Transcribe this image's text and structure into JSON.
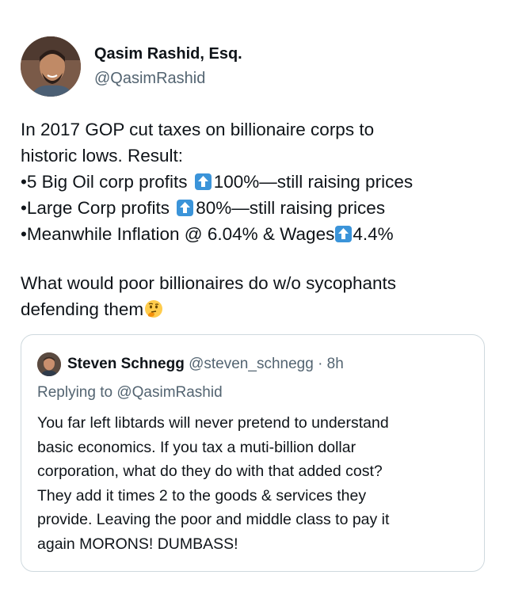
{
  "author": {
    "name": "Qasim Rashid, Esq.",
    "handle": "@QasimRashid"
  },
  "tweet": {
    "line1": "In 2017 GOP cut taxes on billionaire corps to",
    "line2": "historic lows. Result:",
    "bullet1_pre": "•5 Big Oil corp profits",
    "bullet1_post": "100%—still raising prices",
    "bullet2_pre": "•Large Corp profits",
    "bullet2_post": "80%—still raising prices",
    "bullet3_pre": "•Meanwhile Inflation @ 6.04% & Wages",
    "bullet3_post": "4.4%",
    "line6": "What would poor billionaires do w/o sycophants",
    "line7": "defending them",
    "arrow_icon": "up-arrow-emoji",
    "thinking_icon": "thinking-face-emoji"
  },
  "quoted": {
    "name": "Steven Schnegg",
    "handle": "@steven_schnegg",
    "separator": "·",
    "time": "8h",
    "replying": "Replying to @QasimRashid",
    "lines": [
      "You far left libtards will never pretend to understand",
      "basic economics. If you tax a muti-billion dollar",
      "corporation, what do they do with that added cost?",
      "They add it times 2 to the goods & services they",
      "provide. Leaving the poor and middle class to pay it",
      "again MORONS! DUMBASS!"
    ]
  },
  "colors": {
    "text": "#0f1419",
    "secondary": "#536471",
    "border": "#cfd9de",
    "arrow_bg": "#3b94d9"
  }
}
